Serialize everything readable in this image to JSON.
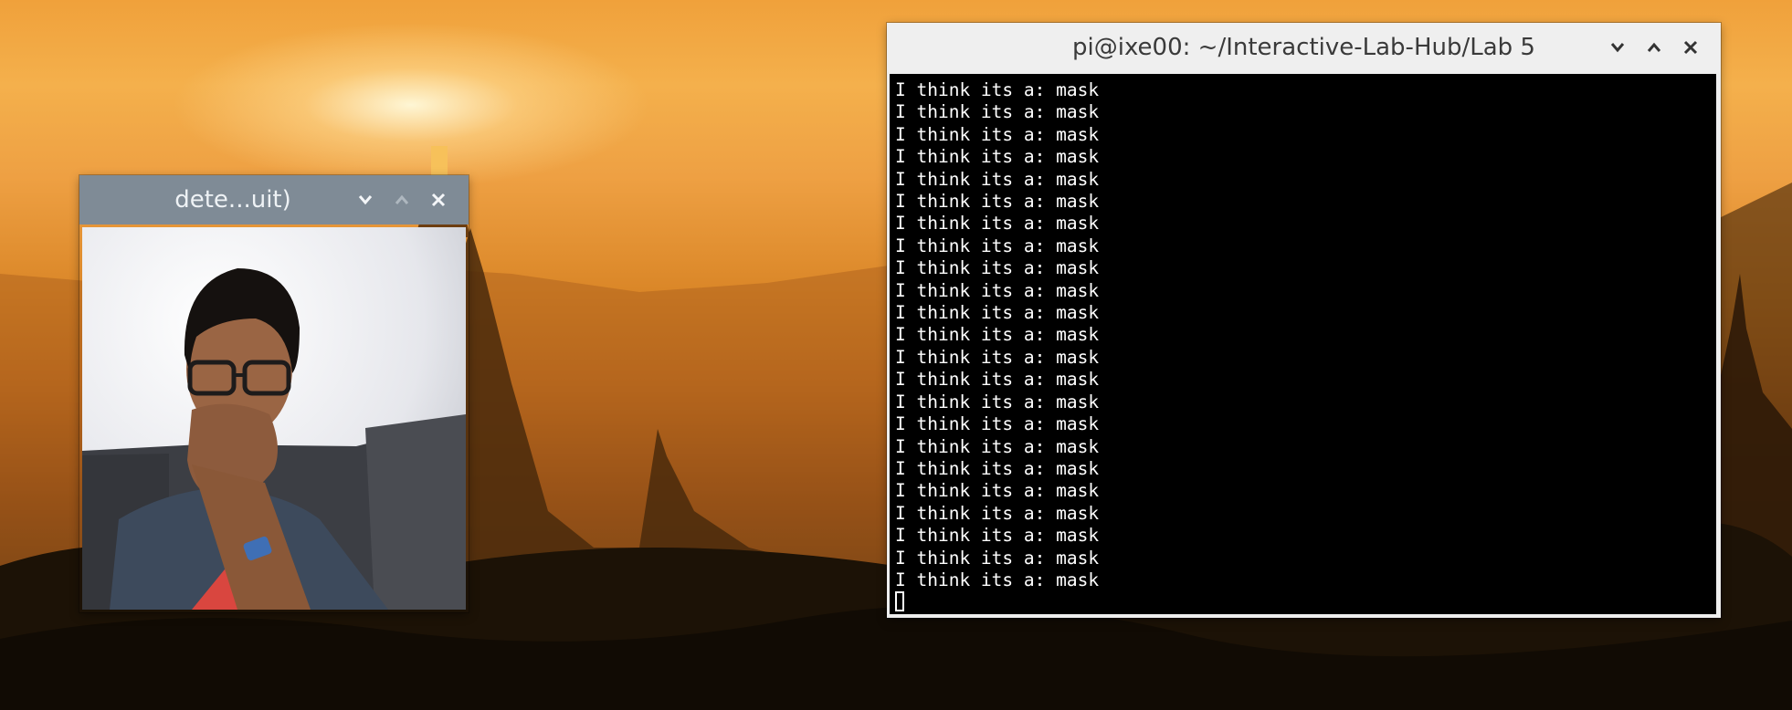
{
  "camera_window": {
    "title": "dete...uit)",
    "minimize_icon": "chevron-down-icon",
    "maximize_icon": "chevron-up-icon",
    "close_icon": "close-icon",
    "content": "camera-preview"
  },
  "terminal_window": {
    "title": "pi@ixe00: ~/Interactive-Lab-Hub/Lab 5",
    "minimize_icon": "chevron-down-icon",
    "maximize_icon": "chevron-up-icon",
    "close_icon": "close-icon",
    "lines": [
      "I think its a: mask",
      "I think its a: mask",
      "I think its a: mask",
      "I think its a: mask",
      "I think its a: mask",
      "I think its a: mask",
      "I think its a: mask",
      "I think its a: mask",
      "I think its a: mask",
      "I think its a: mask",
      "I think its a: mask",
      "I think its a: mask",
      "I think its a: mask",
      "I think its a: mask",
      "I think its a: mask",
      "I think its a: mask",
      "I think its a: mask",
      "I think its a: mask",
      "I think its a: mask",
      "I think its a: mask",
      "I think its a: mask",
      "I think its a: mask",
      "I think its a: mask"
    ]
  },
  "colors": {
    "camera_titlebar": "#7f8b96",
    "terminal_titlebar": "#efefef",
    "terminal_bg": "#000000",
    "terminal_fg": "#ffffff"
  }
}
